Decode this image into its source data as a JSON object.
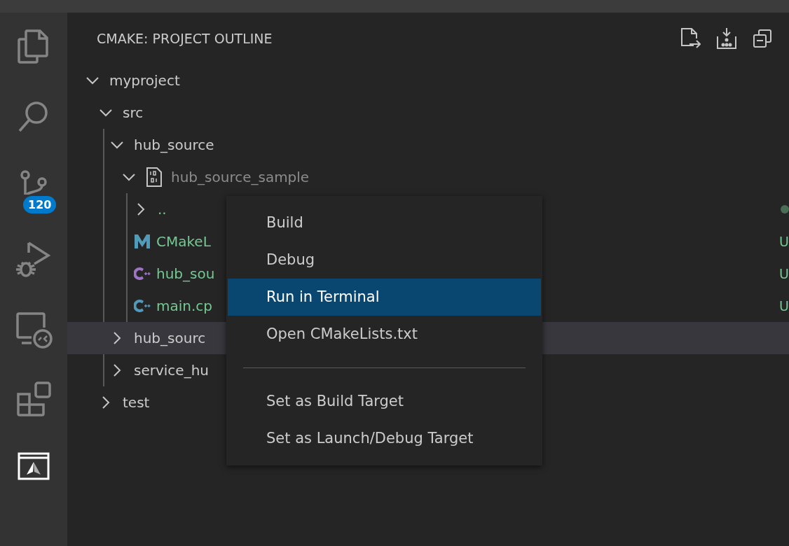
{
  "activity_bar": {
    "items": [
      {
        "kind": "explorer",
        "selected": false
      },
      {
        "kind": "search",
        "selected": false
      },
      {
        "kind": "source_control",
        "selected": false,
        "badge": "120"
      },
      {
        "kind": "run_debug",
        "selected": false
      },
      {
        "kind": "remote",
        "selected": false
      },
      {
        "kind": "extensions",
        "selected": false
      },
      {
        "kind": "cmake",
        "selected": true
      }
    ]
  },
  "panel": {
    "title": "CMAKE: PROJECT OUTLINE",
    "actions": [
      {
        "kind": "export"
      },
      {
        "kind": "download"
      },
      {
        "kind": "collapse"
      }
    ]
  },
  "tree": [
    {
      "label": "myproject",
      "expanded": true,
      "hovered": false,
      "children": [
        {
          "label": "src",
          "expanded": true,
          "hovered": false,
          "children": [
            {
              "label": "hub_source",
              "expanded": true,
              "hovered": false,
              "children": [
                {
                  "label": "hub_source_sample",
                  "kind": "target",
                  "expanded": true,
                  "hovered": false,
                  "children": [
                    {
                      "label": "..",
                      "kind": "parent",
                      "expanded": false,
                      "hovered": false,
                      "dot": true
                    },
                    {
                      "label": "CMakeL",
                      "kind": "cmake",
                      "hovered": false,
                      "dot": false,
                      "decoration": "U"
                    },
                    {
                      "label": "hub_sou",
                      "kind": "cpp",
                      "color": "#a074c4",
                      "hovered": false,
                      "dot": false,
                      "decoration": "U"
                    },
                    {
                      "label": "main.cp",
                      "kind": "cpp",
                      "color": "#519aba",
                      "hovered": false,
                      "dot": false,
                      "decoration": "U"
                    }
                  ]
                }
              ]
            },
            {
              "label": "hub_sourc",
              "expanded": false,
              "hovered": true
            },
            {
              "label": "service_hu",
              "expanded": false,
              "hovered": false
            }
          ]
        },
        {
          "label": "test",
          "expanded": false,
          "hovered": false
        }
      ]
    }
  ],
  "context_menu": [
    {
      "kind": "item",
      "label": "Build",
      "selected": false
    },
    {
      "kind": "item",
      "label": "Debug",
      "selected": false
    },
    {
      "kind": "item",
      "label": "Run in Terminal",
      "selected": true
    },
    {
      "kind": "item",
      "label": "Open CMakeLists.txt",
      "selected": false
    },
    {
      "kind": "separator"
    },
    {
      "kind": "item",
      "label": "Set as Build Target",
      "selected": false
    },
    {
      "kind": "item",
      "label": "Set as Launch/Debug Target",
      "selected": false
    }
  ]
}
